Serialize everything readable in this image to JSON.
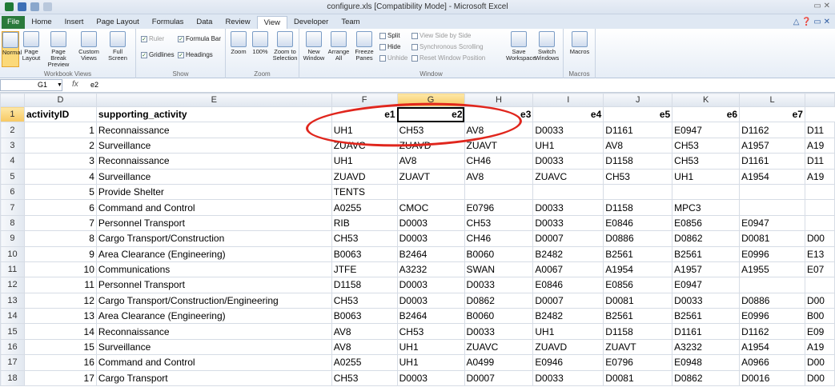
{
  "window": {
    "title": "configure.xls [Compatibility Mode] - Microsoft Excel"
  },
  "tabs": [
    {
      "label": "File",
      "cls": "file"
    },
    {
      "label": "Home",
      "cls": ""
    },
    {
      "label": "Insert",
      "cls": ""
    },
    {
      "label": "Page Layout",
      "cls": ""
    },
    {
      "label": "Formulas",
      "cls": ""
    },
    {
      "label": "Data",
      "cls": ""
    },
    {
      "label": "Review",
      "cls": ""
    },
    {
      "label": "View",
      "cls": "active"
    },
    {
      "label": "Developer",
      "cls": ""
    },
    {
      "label": "Team",
      "cls": ""
    }
  ],
  "ribbon": {
    "workbook_views": {
      "label": "Workbook Views",
      "buttons": [
        "Normal",
        "Page Layout",
        "Page Break Preview",
        "Custom Views",
        "Full Screen"
      ]
    },
    "show": {
      "label": "Show",
      "ruler": "Ruler",
      "formula_bar": "Formula Bar",
      "gridlines": "Gridlines",
      "headings": "Headings"
    },
    "zoom": {
      "label": "Zoom",
      "buttons": [
        "Zoom",
        "100%",
        "Zoom to Selection"
      ]
    },
    "window": {
      "label": "Window",
      "buttons": [
        "New Window",
        "Arrange All",
        "Freeze Panes"
      ],
      "small": [
        "Split",
        "Hide",
        "Unhide"
      ],
      "small2": [
        "View Side by Side",
        "Synchronous Scrolling",
        "Reset Window Position"
      ],
      "buttons2": [
        "Save Workspace",
        "Switch Windows"
      ]
    },
    "macros": {
      "label": "Macros",
      "button": "Macros"
    }
  },
  "formula_bar": {
    "name_box": "G1",
    "fx": "fx",
    "value": "e2"
  },
  "columns": [
    "D",
    "E",
    "F",
    "G",
    "H",
    "I",
    "J",
    "K",
    "L"
  ],
  "rows": [
    [
      "1",
      "activityID",
      "supporting_activity",
      "e1",
      "e2",
      "e3",
      "e4",
      "e5",
      "e6",
      "e7"
    ],
    [
      "2",
      "1",
      "Reconnaissance",
      "UH1",
      "CH53",
      "AV8",
      "D0033",
      "D1161",
      "E0947",
      "D1162",
      "D11"
    ],
    [
      "3",
      "2",
      "Surveillance",
      "ZUAVC",
      "ZUAVD",
      "ZUAVT",
      "UH1",
      "AV8",
      "CH53",
      "A1957",
      "A19"
    ],
    [
      "4",
      "3",
      "Reconnaissance",
      "UH1",
      "AV8",
      "CH46",
      "D0033",
      "D1158",
      "CH53",
      "D1161",
      "D11"
    ],
    [
      "5",
      "4",
      "Surveillance",
      "ZUAVD",
      "ZUAVT",
      "AV8",
      "ZUAVC",
      "CH53",
      "UH1",
      "A1954",
      "A19"
    ],
    [
      "6",
      "5",
      "Provide Shelter",
      "TENTS",
      "",
      "",
      "",
      "",
      "",
      "",
      ""
    ],
    [
      "7",
      "6",
      "Command and Control",
      "A0255",
      "CMOC",
      "E0796",
      "D0033",
      "D1158",
      "MPC3",
      "",
      ""
    ],
    [
      "8",
      "7",
      "Personnel Transport",
      "RIB",
      "D0003",
      "CH53",
      "D0033",
      "E0846",
      "E0856",
      "E0947",
      ""
    ],
    [
      "9",
      "8",
      "Cargo Transport/Construction",
      "CH53",
      "D0003",
      "CH46",
      "D0007",
      "D0886",
      "D0862",
      "D0081",
      "D00"
    ],
    [
      "10",
      "9",
      "Area Clearance (Engineering)",
      "B0063",
      "B2464",
      "B0060",
      "B2482",
      "B2561",
      "B2561",
      "E0996",
      "E13"
    ],
    [
      "11",
      "10",
      "Communications",
      "JTFE",
      "A3232",
      "SWAN",
      "A0067",
      "A1954",
      "A1957",
      "A1955",
      "E07"
    ],
    [
      "12",
      "11",
      "Personnel Transport",
      "D1158",
      "D0003",
      "D0033",
      "E0846",
      "E0856",
      "E0947",
      "",
      ""
    ],
    [
      "13",
      "12",
      "Cargo Transport/Construction/Engineering",
      "CH53",
      "D0003",
      "D0862",
      "D0007",
      "D0081",
      "D0033",
      "D0886",
      "D00"
    ],
    [
      "14",
      "13",
      "Area Clearance (Engineering)",
      "B0063",
      "B2464",
      "B0060",
      "B2482",
      "B2561",
      "B2561",
      "E0996",
      "B00"
    ],
    [
      "15",
      "14",
      "Reconnaissance",
      "AV8",
      "CH53",
      "D0033",
      "UH1",
      "D1158",
      "D1161",
      "D1162",
      "E09"
    ],
    [
      "16",
      "15",
      "Surveillance",
      "AV8",
      "UH1",
      "ZUAVC",
      "ZUAVD",
      "ZUAVT",
      "A3232",
      "A1954",
      "A19"
    ],
    [
      "17",
      "16",
      "Command and Control",
      "A0255",
      "UH1",
      "A0499",
      "E0946",
      "E0796",
      "E0948",
      "A0966",
      "D00"
    ],
    [
      "18",
      "17",
      "Cargo Transport",
      "CH53",
      "D0003",
      "D0007",
      "D0033",
      "D0081",
      "D0862",
      "D0016",
      "D00"
    ]
  ],
  "colors": {
    "annotation": "#e0261d",
    "file_tab": "#2a7a3b",
    "selection": "#f7c861"
  }
}
